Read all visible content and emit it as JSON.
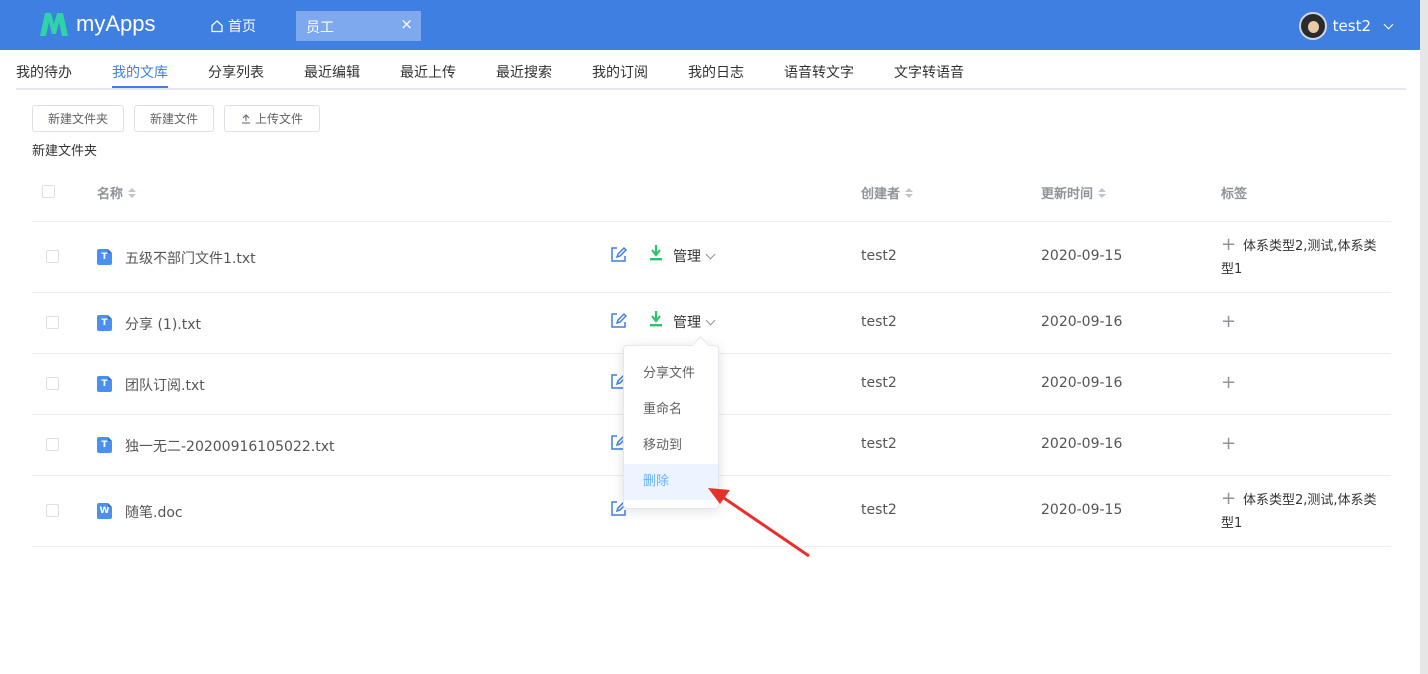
{
  "header": {
    "app_name": "myApps",
    "home_label": "首页",
    "open_tab": "员工",
    "tab_close": "×",
    "username": "test2"
  },
  "nav": {
    "items": [
      "我的待办",
      "我的文库",
      "分享列表",
      "最近编辑",
      "最近上传",
      "最近搜索",
      "我的订阅",
      "我的日志",
      "语音转文字",
      "文字转语音"
    ],
    "active": "我的文库"
  },
  "toolbar": {
    "new_folder": "新建文件夹",
    "new_file": "新建文件",
    "upload": "上传文件"
  },
  "breadcrumb": "新建文件夹",
  "table": {
    "columns": {
      "name": "名称",
      "creator": "创建者",
      "updated": "更新时间",
      "tags": "标签"
    },
    "manage_label": "管理",
    "rows": [
      {
        "name": "五级不部门文件1.txt",
        "type": "T",
        "creator": "test2",
        "updated": "2020-09-15",
        "tags": "体系类型2,测试,体系类型1"
      },
      {
        "name": "分享 (1).txt",
        "type": "T",
        "creator": "test2",
        "updated": "2020-09-16",
        "tags": ""
      },
      {
        "name": "团队订阅.txt",
        "type": "T",
        "creator": "test2",
        "updated": "2020-09-16",
        "tags": ""
      },
      {
        "name": "独一无二-20200916105022.txt",
        "type": "T",
        "creator": "test2",
        "updated": "2020-09-16",
        "tags": ""
      },
      {
        "name": "随笔.doc",
        "type": "W",
        "creator": "test2",
        "updated": "2020-09-15",
        "tags": "体系类型2,测试,体系类型1"
      }
    ]
  },
  "dropdown": {
    "items": [
      "分享文件",
      "重命名",
      "移动到",
      "删除"
    ],
    "highlighted": "删除"
  },
  "colors": {
    "primary": "#3e7fe1",
    "download": "#2dc36a",
    "annotation_arrow": "#e8302a"
  }
}
